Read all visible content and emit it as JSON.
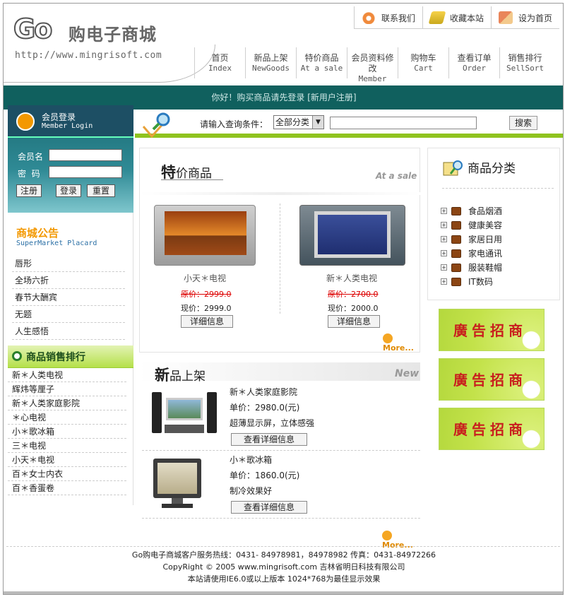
{
  "header": {
    "logo_go": "Go",
    "logo_cn": "购电子商城",
    "logo_url": "http://www.mingrisoft.com",
    "toplinks": [
      {
        "label": "联系我们",
        "icon": "contact-icon"
      },
      {
        "label": "收藏本站",
        "icon": "bookmark-icon"
      },
      {
        "label": "设为首页",
        "icon": "home-icon"
      }
    ],
    "nav": [
      {
        "cn": "首页",
        "en": "Index"
      },
      {
        "cn": "新品上架",
        "en": "NewGoods"
      },
      {
        "cn": "特价商品",
        "en": "At a sale"
      },
      {
        "cn": "会员资料修改",
        "en": "Member"
      },
      {
        "cn": "购物车",
        "en": "Cart"
      },
      {
        "cn": "查看订单",
        "en": "Order"
      },
      {
        "cn": "销售排行",
        "en": "SellSort"
      }
    ]
  },
  "welcome": "你好！购买商品请先登录 [新用户注册]",
  "search": {
    "label": "请输入查询条件：",
    "select_value": "全部分类",
    "input_value": "",
    "button": "搜索"
  },
  "login": {
    "title": "会员登录",
    "subtitle": "Member Login",
    "name_label": "会员名",
    "pwd_label": "密  码",
    "buttons": [
      "注册",
      "登录",
      "重置"
    ]
  },
  "notice": {
    "title": "商城公告",
    "subtitle": "SuperMarket Placard",
    "items": [
      "唇形",
      "全场六折",
      "春节大酬宾",
      "无题",
      "人生感悟"
    ]
  },
  "rank": {
    "title": "商品销售排行",
    "items": [
      "新＊人类电视",
      "辉炜等厘子",
      "新＊人类家庭影院",
      "＊心电视",
      "小＊歌冰箱",
      "三＊电视",
      "小天＊电视",
      "百＊女士内衣",
      "百＊香蛋卷"
    ]
  },
  "special": {
    "title_bold": "特",
    "title_rest": "价商品",
    "title_en": "At a sale",
    "products": [
      {
        "name": "小天＊电视",
        "orig": "原价：2999.0",
        "curr": "现价：2999.0",
        "button": "详细信息"
      },
      {
        "name": "新＊人类电视",
        "orig": "原价：2700.0",
        "curr": "现价：2000.0",
        "button": "详细信息"
      }
    ],
    "more": "More..."
  },
  "newgoods": {
    "title_bold": "新",
    "title_rest": "品上架",
    "title_en": "New",
    "items": [
      {
        "name": "新＊人类家庭影院",
        "price": "单价：2980.0(元)",
        "desc": "超薄显示屏，立体感强",
        "button": "查看详细信息"
      },
      {
        "name": "小＊歌冰箱",
        "price": "单价：1860.0(元)",
        "desc": "制冷效果好",
        "button": "查看详细信息"
      }
    ],
    "more": "More..."
  },
  "category": {
    "title": "商品分类",
    "items": [
      "食品烟酒",
      "健康美容",
      "家居日用",
      "家电通讯",
      "服装鞋帽",
      "IT数码"
    ]
  },
  "ads": [
    "廣告招商",
    "廣告招商",
    "廣告招商"
  ],
  "footer": [
    "Go购电子商城客户服务热线：0431- 84978981，84978982 传真：0431-84972266",
    "CopyRight © 2005 www.mingrisoft.com 吉林省明日科技有限公司",
    "本站请使用IE6.0或以上版本 1024*768为最佳显示效果"
  ],
  "colors": {
    "teal": "#10605e",
    "green": "#8fc31f",
    "price_red": "#dd0000",
    "orange": "#f39800"
  }
}
